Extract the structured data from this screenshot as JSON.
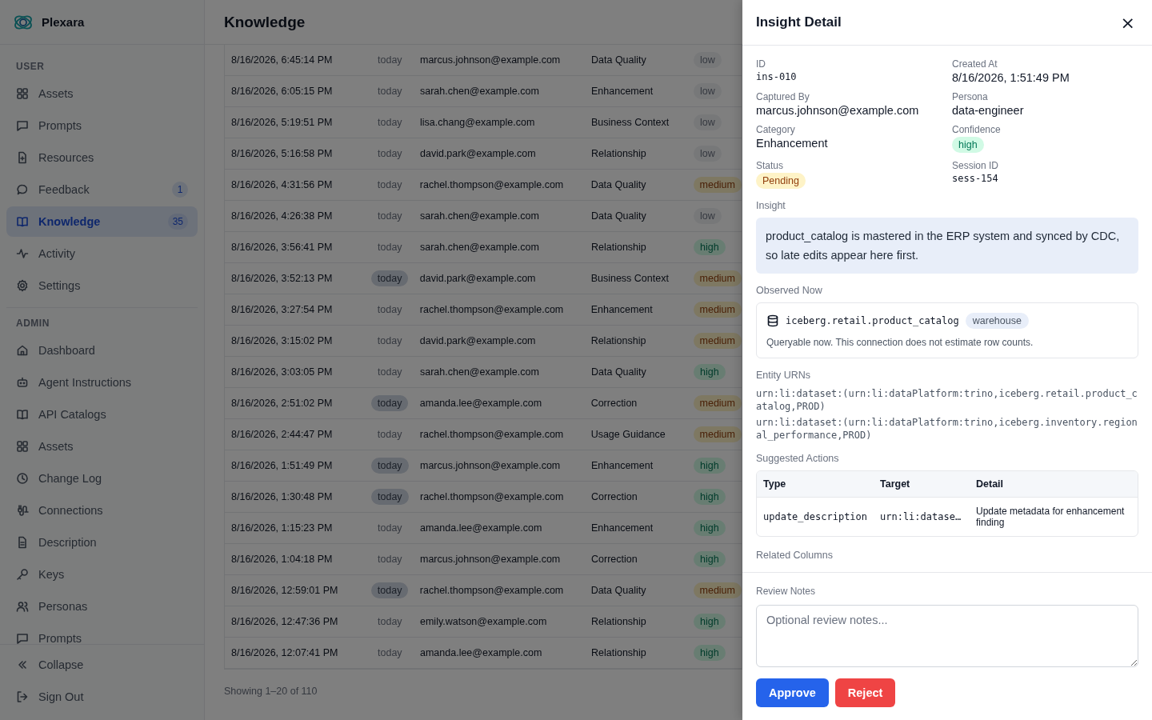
{
  "app": {
    "name": "Plexara"
  },
  "sidebar": {
    "sections": [
      {
        "heading": "USER",
        "items": [
          {
            "label": "Assets",
            "selected": false
          },
          {
            "label": "Prompts",
            "selected": false
          },
          {
            "label": "Resources",
            "selected": false
          },
          {
            "label": "Feedback",
            "selected": false,
            "badge": "1"
          },
          {
            "label": "Knowledge",
            "selected": true,
            "badge": "35"
          },
          {
            "label": "Activity",
            "selected": false
          },
          {
            "label": "Settings",
            "selected": false
          }
        ]
      },
      {
        "heading": "ADMIN",
        "items": [
          {
            "label": "Dashboard",
            "selected": false
          },
          {
            "label": "Agent Instructions",
            "selected": false
          },
          {
            "label": "API Catalogs",
            "selected": false
          },
          {
            "label": "Assets",
            "selected": false
          },
          {
            "label": "Change Log",
            "selected": false
          },
          {
            "label": "Connections",
            "selected": false
          },
          {
            "label": "Description",
            "selected": false
          },
          {
            "label": "Keys",
            "selected": false
          },
          {
            "label": "Personas",
            "selected": false
          },
          {
            "label": "Prompts",
            "selected": false
          }
        ]
      }
    ],
    "footer": [
      {
        "label": "Collapse"
      },
      {
        "label": "Sign Out"
      }
    ]
  },
  "page": {
    "title": "Knowledge",
    "table": {
      "rows": [
        {
          "created": "8/16/2026, 6:45:14 PM",
          "age": "today",
          "age_highlighted": false,
          "user": "marcus.johnson@example.com",
          "category": "Data Quality",
          "confidence": {
            "text": "low",
            "kind": "neutral"
          }
        },
        {
          "created": "8/16/2026, 6:05:15 PM",
          "age": "today",
          "age_highlighted": false,
          "user": "sarah.chen@example.com",
          "category": "Enhancement",
          "confidence": {
            "text": "low",
            "kind": "neutral"
          }
        },
        {
          "created": "8/16/2026, 5:19:51 PM",
          "age": "today",
          "age_highlighted": false,
          "user": "lisa.chang@example.com",
          "category": "Business Context",
          "confidence": {
            "text": "low",
            "kind": "neutral"
          }
        },
        {
          "created": "8/16/2026, 5:16:58 PM",
          "age": "today",
          "age_highlighted": false,
          "user": "david.park@example.com",
          "category": "Relationship",
          "confidence": {
            "text": "low",
            "kind": "neutral"
          }
        },
        {
          "created": "8/16/2026, 4:31:56 PM",
          "age": "today",
          "age_highlighted": false,
          "user": "rachel.thompson@example.com",
          "category": "Data Quality",
          "confidence": {
            "text": "medium",
            "kind": "warning"
          }
        },
        {
          "created": "8/16/2026, 4:26:38 PM",
          "age": "today",
          "age_highlighted": false,
          "user": "sarah.chen@example.com",
          "category": "Data Quality",
          "confidence": {
            "text": "low",
            "kind": "neutral"
          }
        },
        {
          "created": "8/16/2026, 3:56:41 PM",
          "age": "today",
          "age_highlighted": false,
          "user": "sarah.chen@example.com",
          "category": "Relationship",
          "confidence": {
            "text": "high",
            "kind": "success"
          }
        },
        {
          "created": "8/16/2026, 3:52:13 PM",
          "age": "today",
          "age_highlighted": true,
          "user": "david.park@example.com",
          "category": "Business Context",
          "confidence": {
            "text": "medium",
            "kind": "warning"
          }
        },
        {
          "created": "8/16/2026, 3:27:54 PM",
          "age": "today",
          "age_highlighted": false,
          "user": "rachel.thompson@example.com",
          "category": "Enhancement",
          "confidence": {
            "text": "medium",
            "kind": "warning"
          }
        },
        {
          "created": "8/16/2026, 3:15:02 PM",
          "age": "today",
          "age_highlighted": false,
          "user": "david.park@example.com",
          "category": "Relationship",
          "confidence": {
            "text": "medium",
            "kind": "warning"
          }
        },
        {
          "created": "8/16/2026, 3:03:05 PM",
          "age": "today",
          "age_highlighted": false,
          "user": "sarah.chen@example.com",
          "category": "Data Quality",
          "confidence": {
            "text": "high",
            "kind": "success"
          }
        },
        {
          "created": "8/16/2026, 2:51:02 PM",
          "age": "today",
          "age_highlighted": true,
          "user": "amanda.lee@example.com",
          "category": "Correction",
          "confidence": {
            "text": "medium",
            "kind": "warning"
          }
        },
        {
          "created": "8/16/2026, 2:44:47 PM",
          "age": "today",
          "age_highlighted": false,
          "user": "rachel.thompson@example.com",
          "category": "Usage Guidance",
          "confidence": {
            "text": "medium",
            "kind": "warning"
          }
        },
        {
          "created": "8/16/2026, 1:51:49 PM",
          "age": "today",
          "age_highlighted": true,
          "user": "marcus.johnson@example.com",
          "category": "Enhancement",
          "confidence": {
            "text": "high",
            "kind": "success"
          }
        },
        {
          "created": "8/16/2026, 1:30:48 PM",
          "age": "today",
          "age_highlighted": true,
          "user": "rachel.thompson@example.com",
          "category": "Correction",
          "confidence": {
            "text": "high",
            "kind": "success"
          }
        },
        {
          "created": "8/16/2026, 1:15:23 PM",
          "age": "today",
          "age_highlighted": false,
          "user": "amanda.lee@example.com",
          "category": "Enhancement",
          "confidence": {
            "text": "high",
            "kind": "success"
          }
        },
        {
          "created": "8/16/2026, 1:04:18 PM",
          "age": "today",
          "age_highlighted": false,
          "user": "marcus.johnson@example.com",
          "category": "Correction",
          "confidence": {
            "text": "high",
            "kind": "success"
          }
        },
        {
          "created": "8/16/2026, 12:59:01 PM",
          "age": "today",
          "age_highlighted": true,
          "user": "rachel.thompson@example.com",
          "category": "Data Quality",
          "confidence": {
            "text": "medium",
            "kind": "warning"
          }
        },
        {
          "created": "8/16/2026, 12:47:36 PM",
          "age": "today",
          "age_highlighted": false,
          "user": "emily.watson@example.com",
          "category": "Relationship",
          "confidence": {
            "text": "high",
            "kind": "success"
          }
        },
        {
          "created": "8/16/2026, 12:07:41 PM",
          "age": "today",
          "age_highlighted": false,
          "user": "amanda.lee@example.com",
          "category": "Relationship",
          "confidence": {
            "text": "high",
            "kind": "success"
          }
        }
      ]
    },
    "pagination": "Showing 1–20 of 110"
  },
  "drawer": {
    "title": "Insight Detail",
    "close": "×",
    "fields": [
      {
        "label": "ID",
        "value": "ins-010",
        "kind": "mono"
      },
      {
        "label": "Created At",
        "value": "8/16/2026, 1:51:49 PM",
        "kind": "text"
      },
      {
        "label": "Captured By",
        "value": "marcus.johnson@example.com",
        "kind": "text"
      },
      {
        "label": "Persona",
        "value": "data-engineer",
        "kind": "text"
      },
      {
        "label": "Category",
        "value": "Enhancement",
        "kind": "text"
      },
      {
        "label": "Confidence",
        "value": "high",
        "kind": "success"
      },
      {
        "label": "Status",
        "value": "Pending",
        "kind": "caution"
      },
      {
        "label": "Session ID",
        "value": "sess-154",
        "kind": "mono"
      }
    ],
    "insight": {
      "label": "Insight",
      "text": "product_catalog is mastered in the ERP system and synced by CDC, so late edits appear here first."
    },
    "observed": {
      "label": "Observed Now",
      "table": "iceberg.retail.product_catalog",
      "tag": "warehouse",
      "note": "Queryable now. This connection does not estimate row counts."
    },
    "urns": {
      "label": "Entity URNs",
      "items": [
        "urn:li:dataset:(urn:li:dataPlatform:trino,iceberg.retail.product_catalog,PROD)",
        "urn:li:dataset:(urn:li:dataPlatform:trino,iceberg.inventory.regional_performance,PROD)"
      ]
    },
    "actions": {
      "label": "Suggested Actions",
      "columns": [
        "Type",
        "Target",
        "Detail"
      ],
      "rows": [
        [
          "update_description",
          "urn:li:datase…",
          "Update metadata for enhancement finding"
        ]
      ]
    },
    "related": {
      "label": "Related Columns"
    },
    "review": {
      "label": "Review Notes",
      "placeholder": "Optional review notes..."
    },
    "buttons": [
      {
        "label": "Approve",
        "kind": "primary"
      },
      {
        "label": "Reject",
        "kind": "danger"
      }
    ]
  }
}
